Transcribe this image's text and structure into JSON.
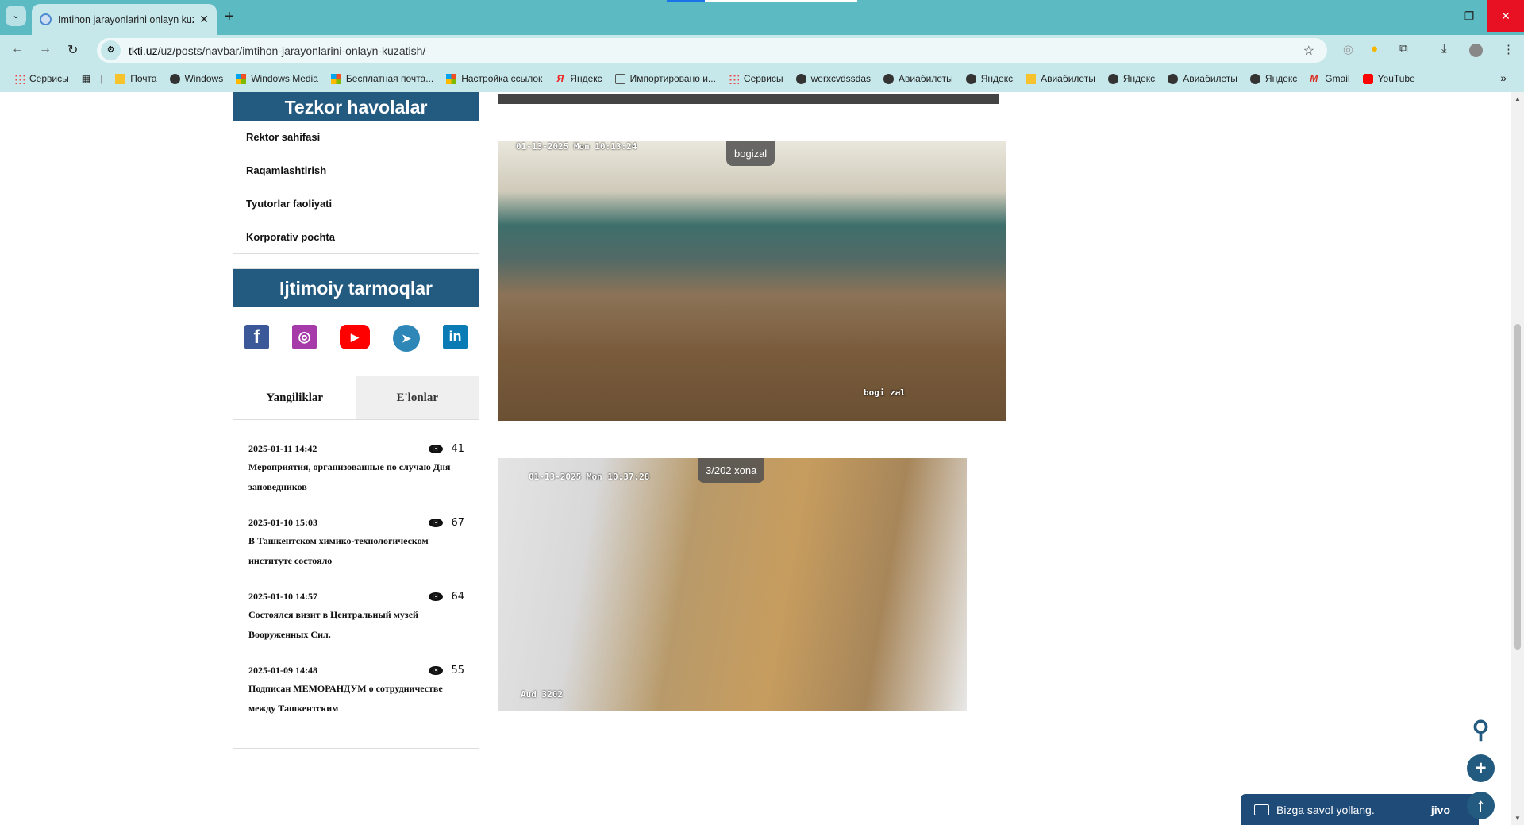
{
  "browser": {
    "tab_title": "Imtihon jarayonlarini onlayn kuzatish",
    "url_host": "tkti.uz",
    "url_path": "/uz/posts/navbar/imtihon-jarayonlarini-onlayn-kuzatish/",
    "bookmarks": [
      "Сервисы",
      "",
      "Почта",
      "Windows",
      "Windows Media",
      "Бесплатная почта...",
      "Настройка ссылок",
      "Яндекс",
      "Импортировано и...",
      "Сервисы",
      "werxcvdssdas",
      "Авиабилеты",
      "Яндекс",
      "Авиабилеты",
      "Яндекс",
      "Авиабилеты",
      "Яндекс",
      "Gmail",
      "YouTube"
    ]
  },
  "sidebar": {
    "quick_links_title": "Tezkor havolalar",
    "quick_links": [
      "Rektor sahifasi",
      "Raqamlashtirish",
      "Tyutorlar faoliyati",
      "Korporativ pochta"
    ],
    "social_title": "Ijtimoiy tarmoqlar",
    "social_icons": [
      "facebook-icon",
      "instagram-icon",
      "youtube-icon",
      "telegram-icon",
      "linkedin-icon"
    ],
    "tabs": [
      "Yangiliklar",
      "E'lonlar"
    ],
    "news": [
      {
        "date": "2025-01-11 14:42",
        "views": "41",
        "title": "Мероприятия, организованные по случаю Дня заповедников"
      },
      {
        "date": "2025-01-10 15:03",
        "views": "67",
        "title": "В Ташкентском химико-технологическом институте состояло"
      },
      {
        "date": "2025-01-10 14:57",
        "views": "64",
        "title": "Состоялся визит в Центральный музей Вооруженных Сил."
      },
      {
        "date": "2025-01-09 14:48",
        "views": "55",
        "title": "Подписан МЕМОРАНДУМ о сотрудничестве между Ташкентским"
      }
    ]
  },
  "cameras": [
    {
      "label": "bogizal",
      "timestamp": "01-13-2025 Mon 10:13:24",
      "caption": "bogi zal"
    },
    {
      "label": "3/202 xona",
      "timestamp": "01-13-2025 Mon 10:37:28",
      "caption": "Aud 3202"
    }
  ],
  "chat": {
    "label": "Bizga savol yollang.",
    "brand": "jivo"
  },
  "colors": {
    "brand": "#235a80",
    "tabbar": "#5bbac2"
  }
}
